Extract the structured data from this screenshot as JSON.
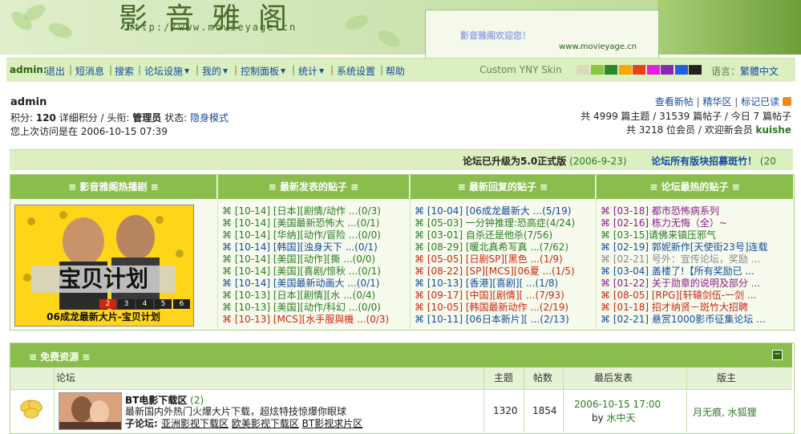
{
  "header": {
    "logo_title": "影音雅阁",
    "logo_url": "http://www.movieyage.cn",
    "welcome": "影音雅阁欢迎您！",
    "site_url": "www.movieyage.cn"
  },
  "nav": {
    "user": "admin:",
    "items": [
      "退出",
      "短消息",
      "搜索",
      "论坛设施",
      "我的",
      "控制面板",
      "统计",
      "系统设置",
      "帮助"
    ],
    "skin_label": "Custom YNY Skin",
    "skin_colors": [
      "#dcd8c0",
      "#8cc63f",
      "#2a8a2a",
      "#f7a700",
      "#e8421a",
      "#e020e0",
      "#8a2ab0",
      "#2060e0",
      "#222222"
    ],
    "lang_label": "语言：",
    "lang_value": "繁體中文"
  },
  "user_info": {
    "name": "admin",
    "score_label": "积分: ",
    "score": "120",
    "detail": " 详细积分 / 头衔: ",
    "title": "管理员",
    "status_label": " 状态: ",
    "status_link": "隐身模式",
    "last_visit": "您上次访问是在 2006-10-15 07:39"
  },
  "stats": {
    "links": [
      "查看新帖",
      "精华区",
      "标记已读"
    ],
    "line1": "共 4999 篇主题 / 31539 篇帖子 / 今日 7 篇帖子",
    "line2_prefix": "共 3218 位会员 / 欢迎新会员 ",
    "new_member": "kuishe"
  },
  "announce": {
    "text1": "论坛已升级为5.0正式版",
    "date1": "(2006-9-23)",
    "text2": "论坛所有版块招募斑竹！",
    "date2": "(20"
  },
  "hot": {
    "col_titles": [
      "≡ 影音雅阁热播剧 ≡",
      "≡ 最新发表的贴子 ≡",
      "≡ 最新回复的贴子 ≡",
      "≡ 论坛最热的贴子 ≡"
    ],
    "poster_caption": "06成龙最新大片-宝贝计划",
    "poster_nums": [
      "2",
      "3",
      "4",
      "5",
      "6"
    ],
    "new_posts": [
      {
        "t": "⌘ [10-14] [日本][剧情/动作 ...(0/3)",
        "c": "green"
      },
      {
        "t": "⌘ [10-14] [美国最新恐怖大 ...(0/1)",
        "c": "green"
      },
      {
        "t": "⌘ [10-14] [华纳][动作/冒险 ...(0/0)",
        "c": "green"
      },
      {
        "t": "⌘ [10-14] [韩国][浊身天下 ...(0/1)",
        "c": "blue"
      },
      {
        "t": "⌘ [10-14] [美国][动作][撕 ...(0/0)",
        "c": "green"
      },
      {
        "t": "⌘ [10-14] [美国][喜剧/惊秋 ...(0/1)",
        "c": "green"
      },
      {
        "t": "⌘ [10-14] [美国最新动画大 ...(0/1)",
        "c": "blue"
      },
      {
        "t": "⌘ [10-13] [日本][剧情][水 ...(0/4)",
        "c": "green"
      },
      {
        "t": "⌘ [10-13] [美国][动作/科幻 ...(0/0)",
        "c": "green"
      },
      {
        "t": "⌘ [10-13] [MCS][水手服與機 ...(0/3)",
        "c": "red"
      }
    ],
    "new_replies": [
      {
        "t": "⌘ [10-04] [06成龙最新大 ...(5/19)",
        "c": "blue"
      },
      {
        "t": "⌘ [05-03] 一分钟推理:恐高症(4/24)",
        "c": "green"
      },
      {
        "t": "⌘ [03-01] 自杀还是他杀(7/56)",
        "c": "green"
      },
      {
        "t": "⌘ [08-29] [暖北真希写真 ...(7/62)",
        "c": "green"
      },
      {
        "t": "⌘ [05-05] [日剧SP][黑色 ...(1/9)",
        "c": "red"
      },
      {
        "t": "⌘ [08-22] [SP][MCS][06夏 ...(1/5)",
        "c": "red"
      },
      {
        "t": "⌘ [10-13] [香港][喜剧][ ...(1/8)",
        "c": "blue"
      },
      {
        "t": "⌘ [09-17] [中国][剧情][ ...(7/93)",
        "c": "red"
      },
      {
        "t": "⌘ [10-05] [韩国最新动作 ...(2/19)",
        "c": "red"
      },
      {
        "t": "⌘ [10-11] [06日本新片][ ...(2/13)",
        "c": "blue"
      }
    ],
    "hot_posts": [
      {
        "t": "⌘ [03-18] 都市恐怖病系列",
        "c": "purple"
      },
      {
        "t": "⌘ [02-16] 栋力无悔（全）~",
        "c": "purple"
      },
      {
        "t": "⌘ [03-15]请佛来镇压邪气",
        "c": "green"
      },
      {
        "t": "⌘ [02-19] 郭妮新作[天使街23号]连载",
        "c": "blue"
      },
      {
        "t": "⌘ [02-21] 号外：宣传论坛，奖励 ...",
        "c": "gray"
      },
      {
        "t": "⌘ [03-04] 盖楼了!【所有奖励已 ...",
        "c": "blue"
      },
      {
        "t": "⌘ [01-22] 关于勋章的说明及部分 ...",
        "c": "purple"
      },
      {
        "t": "⌘ [08-05] [RPG][轩辕剑伍-一剑 ...",
        "c": "red"
      },
      {
        "t": "⌘ [01-18] 招才纳贤－斑竹大招聘",
        "c": "red"
      },
      {
        "t": "⌘ [02-21] 悬赏1000影币征集论坛 ...",
        "c": "blue"
      }
    ]
  },
  "forum": {
    "section_title": "≡ 免费资源 ≡",
    "collapse": "−",
    "col_forum": "论坛",
    "col_topics": "主题",
    "col_posts": "帖数",
    "col_last": "最后发表",
    "col_mod": "版主",
    "row": {
      "name": "BT电影下载区",
      "count": "(2)",
      "desc": "最新国内外热门火爆大片下载，超炫特技惊爆你眼球",
      "sub_label": "子论坛: ",
      "subs": [
        "亚洲影视下载区",
        "欧美影视下载区",
        "BT影视求片区"
      ],
      "topics": "1320",
      "posts": "1854",
      "last_date": "2006-10-15 17:00",
      "last_by_prefix": "by ",
      "last_by": "水中天",
      "mods": "月无痕, 水狐狸"
    }
  }
}
